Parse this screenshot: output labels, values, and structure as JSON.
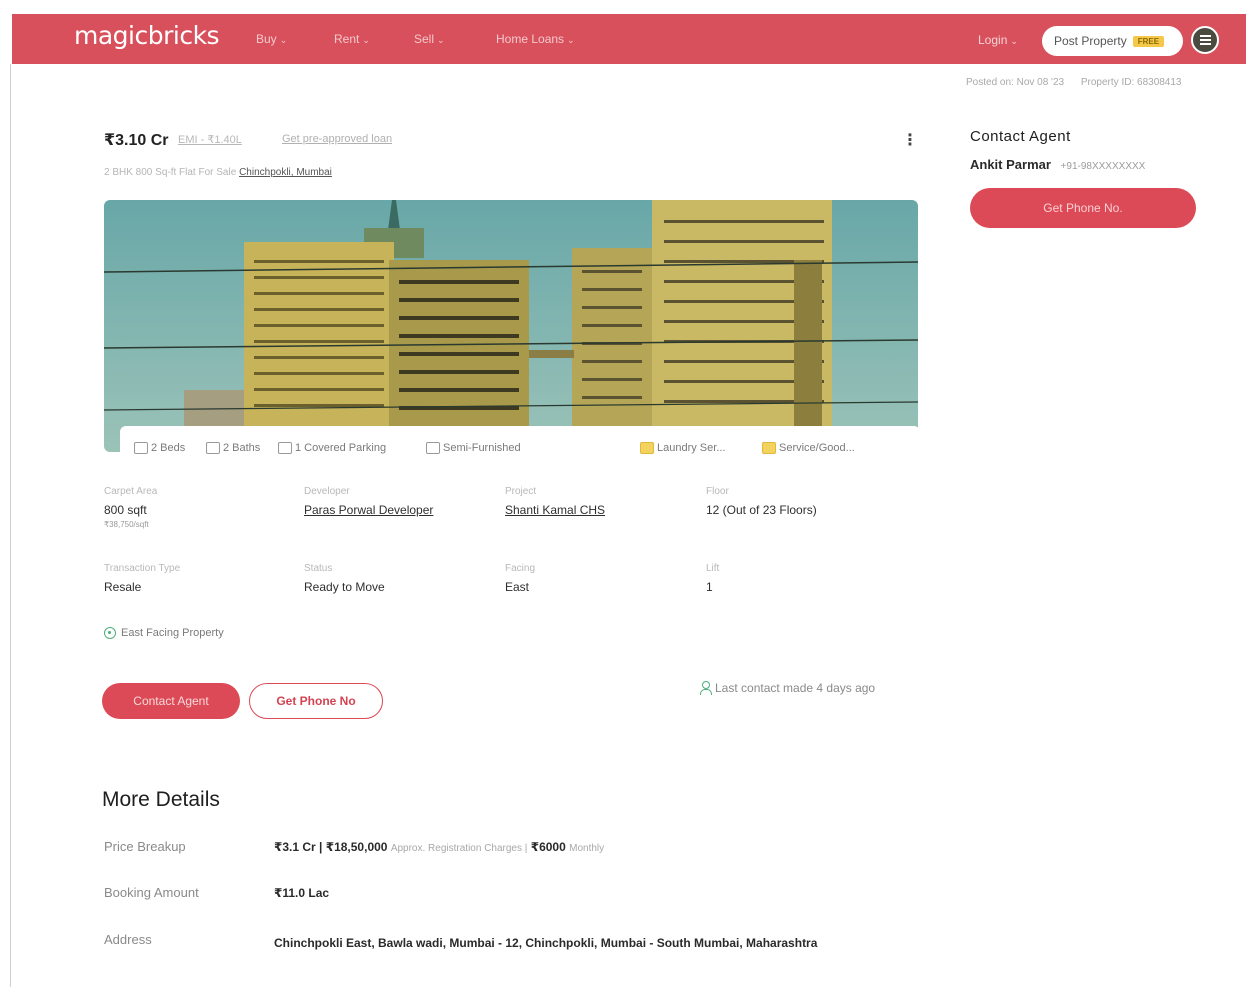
{
  "header": {
    "logo": "magicbricks",
    "nav": [
      "Buy",
      "Rent",
      "Sell",
      "Home Loans"
    ],
    "login": "Login",
    "post_property": "Post Property",
    "post_badge": "FREE",
    "brand_color": "#d9505d"
  },
  "meta": {
    "posted_on": "Posted on: Nov 08 '23",
    "property_id": "Property ID: 68308413"
  },
  "listing": {
    "price": "₹3.10 Cr",
    "emi": "EMI - ₹1.40L",
    "preapproved": "Get pre-approved loan",
    "subtitle_prefix": "2 BHK 800 Sq-ft Flat For Sale",
    "subtitle_location": "Chinchpokli, Mumbai"
  },
  "features": [
    {
      "icon": "bed-icon",
      "label": "2 Beds"
    },
    {
      "icon": "bath-icon",
      "label": "2 Baths"
    },
    {
      "icon": "parking-icon",
      "label": "1 Covered Parking"
    },
    {
      "icon": "furnishing-icon",
      "label": "Semi-Furnished"
    },
    {
      "icon": "laundry-icon",
      "label": "Laundry Ser..."
    },
    {
      "icon": "service-icon",
      "label": "Service/Good..."
    }
  ],
  "specs": [
    {
      "label": "Carpet Area",
      "value": "800 sqft",
      "sub": "₹38,750/sqft"
    },
    {
      "label": "Developer",
      "value": "Paras Porwal Developer"
    },
    {
      "label": "Project",
      "value": "Shanti Kamal CHS"
    },
    {
      "label": "Floor",
      "value": "12 (Out of 23 Floors)"
    },
    {
      "label": "Transaction Type",
      "value": "Resale"
    },
    {
      "label": "Status",
      "value": "Ready to Move"
    },
    {
      "label": "Facing",
      "value": "East"
    },
    {
      "label": "Lift",
      "value": "1"
    }
  ],
  "tag": "East Facing Property",
  "actions": {
    "contact_agent": "Contact Agent",
    "get_phone": "Get Phone No",
    "last_contact": "Last contact made 4 days ago"
  },
  "more_details": {
    "title": "More Details",
    "price_breakup_label": "Price Breakup",
    "price_breakup_value": "₹3.1 Cr | ₹18,50,000",
    "price_breakup_note": "Approx. Registration Charges |",
    "price_breakup_monthly": "₹6000",
    "price_breakup_monthly_note": "Monthly",
    "booking_label": "Booking Amount",
    "booking_value": "₹11.0 Lac",
    "address_label": "Address",
    "address_value": "Chinchpokli East, Bawla wadi, Mumbai - 12, Chinchpokli, Mumbai - South Mumbai, Maharashtra"
  },
  "sidebar": {
    "title": "Contact Agent",
    "agent_name": "Ankit Parmar",
    "agent_phone": "+91-98XXXXXXXX",
    "button": "Get Phone No."
  }
}
